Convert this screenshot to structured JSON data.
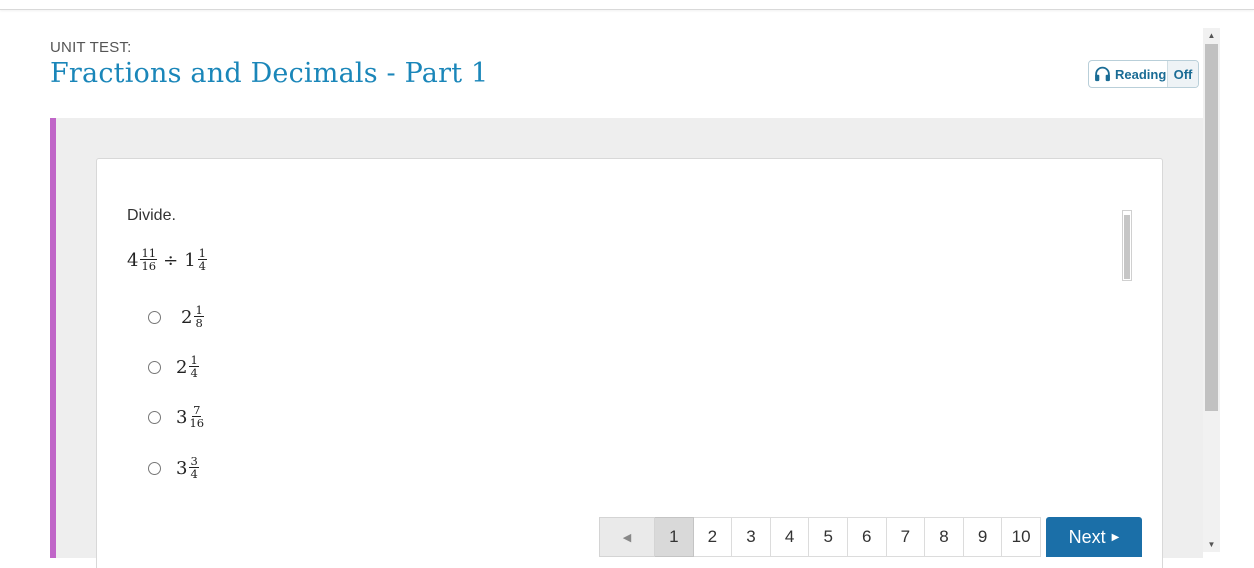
{
  "header": {
    "unit_label": "UNIT TEST:",
    "title": "Fractions and Decimals - Part 1",
    "reading": {
      "label": "Reading",
      "state": "Off",
      "icon": "headphones-icon"
    }
  },
  "question": {
    "prompt": "Divide.",
    "expression": {
      "first": {
        "whole": "4",
        "num": "11",
        "den": "16"
      },
      "operator": "÷",
      "second": {
        "whole": "1",
        "num": "1",
        "den": "4"
      }
    },
    "options": [
      {
        "whole": "2",
        "num": "1",
        "den": "8"
      },
      {
        "whole": "2",
        "num": "1",
        "den": "4"
      },
      {
        "whole": "3",
        "num": "7",
        "den": "16"
      },
      {
        "whole": "3",
        "num": "3",
        "den": "4"
      }
    ]
  },
  "pager": {
    "prev_icon": "◀",
    "pages": [
      "1",
      "2",
      "3",
      "4",
      "5",
      "6",
      "7",
      "8",
      "9",
      "10"
    ],
    "current": "1",
    "next_label": "Next",
    "next_icon": "▶"
  },
  "colors": {
    "title": "#1a86b9",
    "accent_bar": "#c066c8",
    "next_button": "#1b6fa8"
  }
}
